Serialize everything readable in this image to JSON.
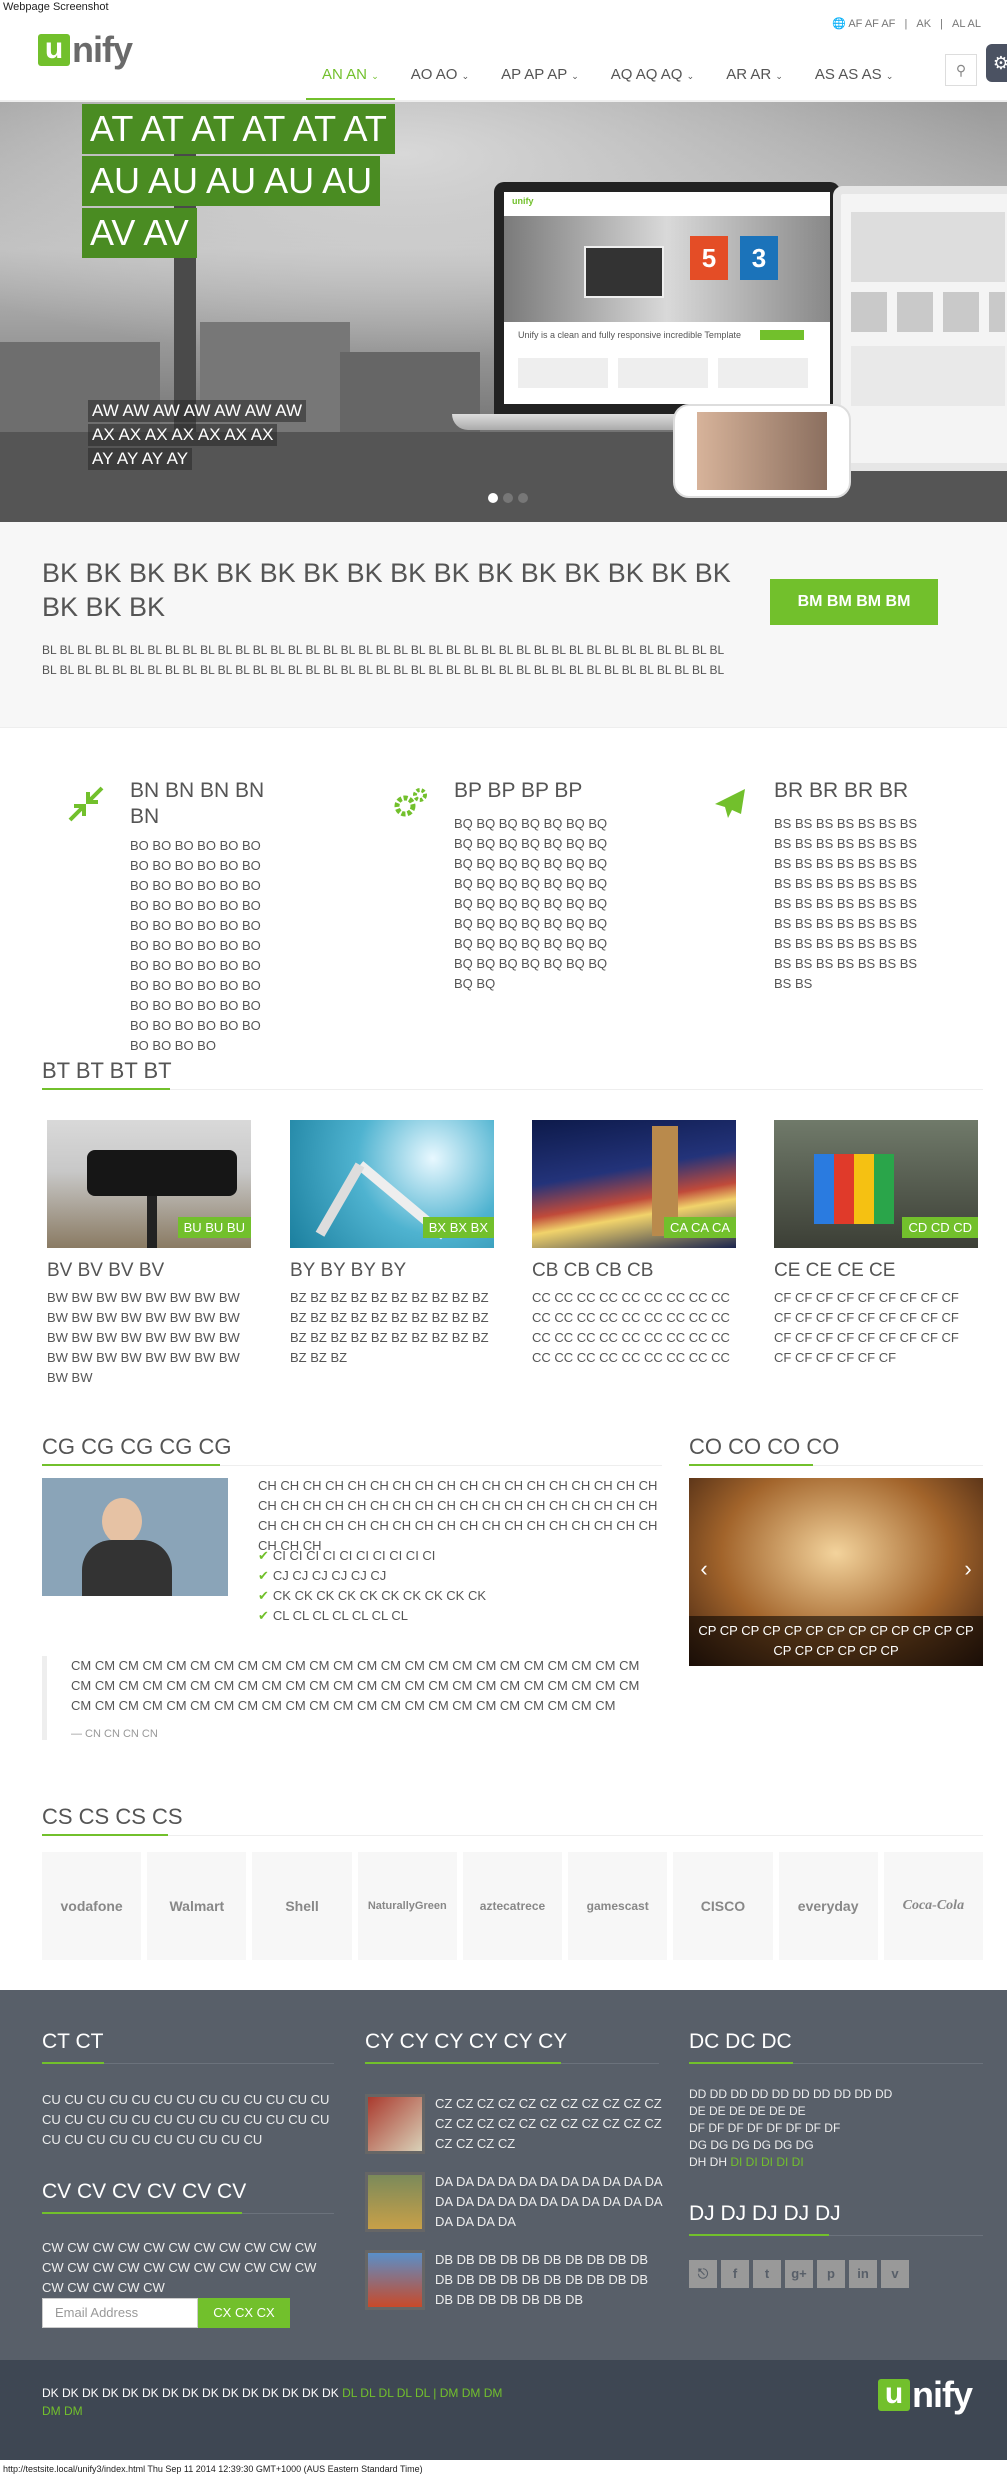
{
  "caption_top": "Webpage Screenshot",
  "caption_bottom": "http://testsite.local/unify3/index.html Thu Sep 11 2014 12:39:30 GMT+1000 (AUS Eastern Standard Time)",
  "topbar": {
    "language": "AF AF AF",
    "link1": "AK",
    "link2": "AL AL"
  },
  "logo": {
    "u": "u",
    "rest": "nify"
  },
  "nav": [
    "AN AN",
    "AO AO",
    "AP AP AP",
    "AQ AQ AQ",
    "AR AR",
    "AS AS AS"
  ],
  "hero": {
    "line1": "AT AT AT AT AT AT",
    "line2": "AU AU AU AU AU",
    "line3": "AV AV",
    "sub1": "AW AW AW AW AW AW AW",
    "sub2": "AX AX AX AX AX AX AX",
    "sub3": "AY AY AY AY",
    "laptop_tagline": "Unify is a clean and fully responsive incredible Template"
  },
  "purchase": {
    "title": "BK BK BK BK BK BK BK BK BK BK BK BK BK BK BK BK BK BK BK",
    "text": "BL BL BL BL BL BL BL BL BL BL BL BL BL BL BL BL BL BL BL BL BL BL BL BL BL BL BL BL BL BL BL BL BL BL BL BL BL BL BL BL BL BL BL BL BL BL BL BL BL BL BL BL BL BL BL BL BL BL BL BL BL BL BL BL BL BL BL BL BL BL BL BL BL BL BL BL BL BL",
    "button": "BM BM BM BM"
  },
  "services": [
    {
      "icon": "compress-arrows-icon",
      "title": "BN BN BN BN BN",
      "text": "BO BO BO BO BO BO BO BO BO BO BO BO BO BO BO BO BO BO BO BO BO BO BO BO BO BO BO BO BO BO BO BO BO BO BO BO BO BO BO BO BO BO BO BO BO BO BO BO BO BO BO BO BO BO BO BO BO BO BO BO BO BO BO BO"
    },
    {
      "icon": "gears-icon",
      "title": "BP BP BP BP",
      "text": "BQ BQ BQ BQ BQ BQ BQ BQ BQ BQ BQ BQ BQ BQ BQ BQ BQ BQ BQ BQ BQ BQ BQ BQ BQ BQ BQ BQ BQ BQ BQ BQ BQ BQ BQ BQ BQ BQ BQ BQ BQ BQ BQ BQ BQ BQ BQ BQ BQ BQ BQ BQ BQ BQ BQ BQ BQ BQ"
    },
    {
      "icon": "plane-icon",
      "title": "BR BR BR BR",
      "text": "BS BS BS BS BS BS BS BS BS BS BS BS BS BS BS BS BS BS BS BS BS BS BS BS BS BS BS BS BS BS BS BS BS BS BS BS BS BS BS BS BS BS BS BS BS BS BS BS BS BS BS BS BS BS BS BS BS BS"
    }
  ],
  "works_heading": "BT BT BT BT",
  "works": [
    {
      "tag": "BU BU BU",
      "title": "BV BV BV BV",
      "text": "BW BW BW BW BW BW BW BW BW BW BW BW BW BW BW BW BW BW BW BW BW BW BW BW BW BW BW BW BW BW BW BW BW BW"
    },
    {
      "tag": "BX BX BX",
      "title": "BY BY BY BY",
      "text": "BZ BZ BZ BZ BZ BZ BZ BZ BZ BZ BZ BZ BZ BZ BZ BZ BZ BZ BZ BZ BZ BZ BZ BZ BZ BZ BZ BZ BZ BZ BZ BZ BZ"
    },
    {
      "tag": "CA CA CA",
      "title": "CB CB CB CB",
      "text": "CC CC CC CC CC CC CC CC CC CC CC CC CC CC CC CC CC CC CC CC CC CC CC CC CC CC CC CC CC CC CC CC CC CC CC CC"
    },
    {
      "tag": "CD CD CD",
      "title": "CE CE CE CE",
      "text": "CF CF CF CF CF CF CF CF CF CF CF CF CF CF CF CF CF CF CF CF CF CF CF CF CF CF CF CF CF CF CF CF CF"
    }
  ],
  "about": {
    "heading": "CG CG CG CG CG",
    "text": "CH CH CH CH CH CH CH CH CH CH CH CH CH CH CH CH CH CH CH CH CH CH CH CH CH CH CH CH CH CH CH CH CH CH CH CH CH CH CH CH CH CH CH CH CH CH CH CH CH CH CH CH CH CH CH CH CH",
    "checks": [
      "CI CI CI CI CI CI CI CI CI CI",
      "CJ CJ CJ CJ CJ CJ",
      "CK CK CK CK CK CK CK CK CK CK",
      "CL CL CL CL CL CL CL"
    ],
    "quote": "CM CM CM CM CM CM CM CM CM CM CM CM CM CM CM CM CM CM CM CM CM CM CM CM CM CM CM CM CM CM CM CM CM CM CM CM CM CM CM CM CM CM CM CM CM CM CM CM CM CM CM CM CM CM CM CM CM CM CM CM CM CM CM CM CM CM CM CM CM CM CM",
    "quote_author": "— CN CN CN CN"
  },
  "recent": {
    "heading": "CO CO CO CO",
    "caption": "CP CP CP CP CP CP CP CP CP CP CP CP CP CP CP CP CP CP CP"
  },
  "clients_heading": "CS CS CS CS",
  "clients": [
    "vodafone",
    "Walmart",
    "Shell",
    "NaturallyGreen",
    "aztecatrece",
    "gamescast",
    "CISCO",
    "everyday",
    "Coca-Cola"
  ],
  "footer": {
    "about_heading": "CT CT",
    "about_text": "CU CU CU CU CU CU CU CU CU CU CU CU CU CU CU CU CU CU CU CU CU CU CU CU CU CU CU CU CU CU CU CU CU CU CU CU",
    "newsletter_heading": "CV CV CV CV CV CV",
    "newsletter_text": "CW CW CW CW CW CW CW CW CW CW CW CW CW CW CW CW CW CW CW CW CW CW CW CW CW CW CW",
    "email_placeholder": "Email Address",
    "subscribe": "CX CX CX",
    "posts_heading": "CY CY CY CY CY CY",
    "posts": [
      "CZ CZ CZ CZ CZ CZ CZ CZ CZ CZ CZ CZ CZ CZ CZ CZ CZ CZ CZ CZ CZ CZ CZ CZ CZ CZ",
      "DA DA DA DA DA DA DA DA DA DA DA DA DA DA DA DA DA DA DA DA DA DA DA DA DA DA",
      "DB DB DB DB DB DB DB DB DB DB DB DB DB DB DB DB DB DB DB DB DB DB DB DB DB DB DB"
    ],
    "contact_heading": "DC DC DC",
    "contact_lines": [
      "DD DD DD DD DD DD DD DD DD DD",
      "DE DE DE DE DE DE",
      "DF DF DF DF DF DF DF DF",
      "DG DG DG DG DG DG"
    ],
    "contact_last": "DH DH",
    "contact_email": "DI DI DI DI DI",
    "social_heading": "DJ DJ DJ DJ DJ",
    "social": [
      "rss-icon",
      "facebook-icon",
      "twitter-icon",
      "google-plus-icon",
      "pinterest-icon",
      "linkedin-icon",
      "vimeo-icon"
    ],
    "copyright": "DK DK DK DK DK DK DK DK DK DK DK DK DK DK DK",
    "link1": "DL DL DL DL DL",
    "sep": "|",
    "link2": "DM DM DM DM DM"
  },
  "colors": {
    "accent": "#72c02c",
    "footer": "#585f69",
    "copyright": "#3e4753"
  }
}
